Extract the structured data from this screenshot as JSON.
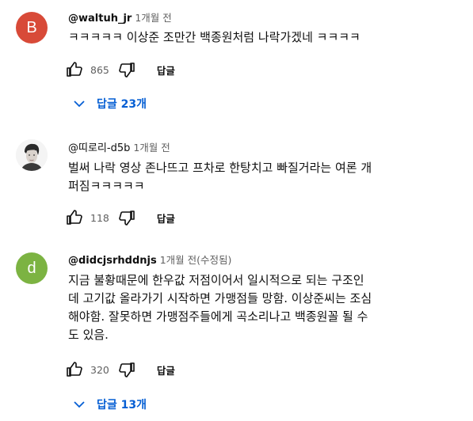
{
  "comments": [
    {
      "author": "@waltuh_jr",
      "time": "1개월 전",
      "avatar_letter": "B",
      "avatar_color": "#d84a38",
      "text": "ㅋㅋㅋㅋㅋ 이상준 조만간 백종원처럼 나락가겠네 ㅋㅋㅋㅋ",
      "likes": "865",
      "reply_label": "답글",
      "replies_toggle_label": "답글 23개"
    },
    {
      "author": "@띠로리-d5b",
      "time": "1개월 전",
      "avatar_icon": "person-photo-avatar",
      "text": "벌써 나락 영상 존나뜨고 프차로 한탕치고 빠질거라는 여론 개\n퍼짐ㅋㅋㅋㅋㅋ",
      "likes": "118",
      "reply_label": "답글"
    },
    {
      "author": "@didcjsrhddnjs",
      "time": "1개월 전(수정됨)",
      "avatar_letter": "d",
      "avatar_color": "#7cb342",
      "text": "지금 불황때문에 한우값 저점이어서 일시적으로 되는 구조인\n데 고기값 올라가기 시작하면 가맹점들 망함. 이상준씨는 조심\n해야함. 잘못하면 가맹점주들에게 곡소리나고 백종원꼴 될 수\n도 있음.",
      "likes": "320",
      "reply_label": "답글",
      "replies_toggle_label": "답글 13개"
    }
  ],
  "accent_color": "#065fd4"
}
